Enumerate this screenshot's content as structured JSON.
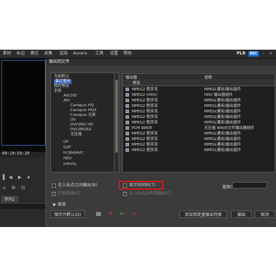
{
  "menubar": {
    "items": [
      "素材",
      "标记",
      "模式",
      "采集",
      "渲染",
      "Aurora",
      "工具",
      "设置",
      "帮助"
    ],
    "logo_text": "PLR",
    "logo_badge": "REC"
  },
  "editor": {
    "timecode": "00:10:59:20",
    "sequence_tab": "序列2"
  },
  "dialog": {
    "title": "输出到文件",
    "tree": {
      "items": [
        {
          "label": "当前默认",
          "selected": false
        },
        {
          "label": "最近使用",
          "selected": true
        },
        {
          "label": "我的预设",
          "selected": false
        },
        {
          "label": "全部",
          "selected": false
        },
        {
          "label": "AVCHD",
          "selected": false
        },
        {
          "label": "AVI",
          "selected": false
        },
        {
          "label": "Canopus HQ",
          "selected": false
        },
        {
          "label": "Canopus HQX",
          "selected": false
        },
        {
          "label": "Canopus 无损",
          "selected": false
        },
        {
          "label": "DV",
          "selected": false
        },
        {
          "label": "DVCPRO HD",
          "selected": false
        },
        {
          "label": "DVCPRO50",
          "selected": false
        },
        {
          "label": "无压缩",
          "selected": false
        },
        {
          "label": "GF",
          "selected": false
        },
        {
          "label": "GXF",
          "selected": false
        },
        {
          "label": "H.264/AVC",
          "selected": false
        },
        {
          "label": "HDV",
          "selected": false
        },
        {
          "label": "Infinity",
          "selected": false
        }
      ]
    },
    "list": {
      "col_exporter": "输出器",
      "col_description": "说明",
      "subheader": "预设",
      "rows": [
        {
          "name": "MPEG2 程序流",
          "desc": "MPEG(通用)输出插件"
        },
        {
          "name": "MPEG2 (HDV)",
          "desc": "HDV 输出器插件"
        },
        {
          "name": "MPEG2 程序流",
          "desc": "MPEG(通用)输出插件"
        },
        {
          "name": "MPEG2 程序流",
          "desc": "MPEG(通用)输出插件"
        },
        {
          "name": "MPEG2 程序流",
          "desc": "MPEG(通用)输出插件"
        },
        {
          "name": "MPEG2 程序流",
          "desc": "MPEG(通用)输出插件"
        },
        {
          "name": "MPEG2 程序流",
          "desc": "MPEG(通用)输出插件"
        },
        {
          "name": "PCM WAVE",
          "desc": "无压缩 WAVE文件输出器插件"
        },
        {
          "name": "MPEG2 程序流",
          "desc": "MPEG(通用)输出插件"
        },
        {
          "name": "MPEG2 程序流",
          "desc": "MPEG(通用)输出插件"
        },
        {
          "name": "MPEG2 程序流",
          "desc": "MPEG(通用)输出插件"
        },
        {
          "name": "MPEG2 程序流",
          "desc": "MPEG(通用)输出插件"
        }
      ]
    },
    "options": {
      "in_out_only": "在入出点之间输出(B)",
      "enable_convert": "开启转换(E)",
      "show_timecode": "显示时间码(T)",
      "in_out_16_9": "以 16bit/2声道输出(C)"
    },
    "search_label": "搜索(S):",
    "search_placeholder": "",
    "advanced": "高级",
    "buttons": {
      "save_default": "保存为默认(D)",
      "add_batch": "添加到批量输出列表",
      "export": "输出",
      "cancel": "取消"
    }
  },
  "colors": {
    "highlight_box": "#d21a1a",
    "selection": "#2e5aa8",
    "accent_blue": "#1d6fd1"
  }
}
